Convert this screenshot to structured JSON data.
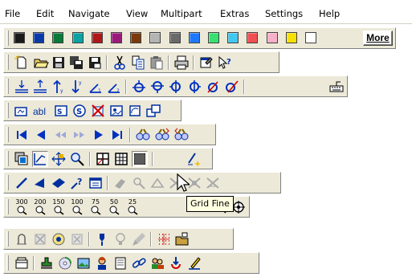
{
  "menu": [
    "File",
    "Edit",
    "Navigate",
    "View",
    "Multipart",
    "Extras",
    "Settings",
    "Help"
  ],
  "palette": {
    "colors": [
      "#1a1a1a",
      "#0a3aa8",
      "#0a7a3a",
      "#0aa2a2",
      "#b01818",
      "#9a1a7a",
      "#7a3a0a",
      "#b4b4b4",
      "#6a6a6a",
      "#1e78ff",
      "#38e070",
      "#40c8f0",
      "#f05050",
      "#f8b0c8",
      "#f8e000",
      "#ffffff"
    ],
    "more_label": "More"
  },
  "tooltip": "Grid Fine",
  "toolbars": {
    "zoom": {
      "labels": [
        "300",
        "200",
        "150",
        "100",
        "75",
        "50",
        "25"
      ]
    }
  },
  "icons": [
    "new-file-icon",
    "open-folder-icon",
    "save-icon",
    "save-all-icon",
    "save-as-icon",
    "cut-icon",
    "copy-icon",
    "paste-icon",
    "print-icon",
    "properties-icon",
    "whats-this-help-icon",
    "align-top-icon",
    "align-bottom-icon",
    "move-up-icon",
    "move-down-icon",
    "angle-up-icon",
    "angle-down-icon",
    "node-top-icon",
    "node-bottom-icon",
    "node-left-icon",
    "node-right-icon",
    "node-delete-icon",
    "node-edit-icon",
    "keyboard-icon",
    "insert-graphic-icon",
    "text-abl-icon",
    "insert-note-icon",
    "symbol-icon",
    "delete-object-icon",
    "insert-image-icon",
    "rotate-object-icon",
    "group-objects-icon",
    "first-page-icon",
    "previous-page-icon",
    "rewind-icon",
    "fast-forward-icon",
    "next-page-icon",
    "last-page-icon",
    "find-icon",
    "find-next-icon",
    "find-previous-icon",
    "layers-icon",
    "draw-edit-icon",
    "move-object-icon",
    "zoom-search-icon",
    "grid-coarse-icon",
    "grid-medium-icon",
    "grid-fine-icon",
    "pen-sparkle-icon",
    "draw-line-icon",
    "arrow-left-icon",
    "arrow-diamond-icon",
    "query-arrow-icon",
    "window-dialog-icon",
    "tool-disabled-1-icon",
    "tool-disabled-2-icon",
    "tool-disabled-3-icon",
    "tool-disabled-4-icon",
    "tool-disabled-5-icon",
    "tool-disabled-6-icon",
    "zoom-300-icon",
    "zoom-200-icon",
    "zoom-150-icon",
    "zoom-100-icon",
    "zoom-75-icon",
    "zoom-50-icon",
    "zoom-25-icon",
    "zoom-custom-icon",
    "zoom-fit-icon",
    "help-tool-icon",
    "cancel-tool-icon",
    "record-icon",
    "stop-disabled-icon",
    "marker-icon",
    "bulb-disabled-icon",
    "brush-disabled-icon",
    "grid-dots-icon",
    "folder-export-icon",
    "trash-toolbar-icon",
    "stamp-icon",
    "cd-target-icon",
    "picture-edit-icon",
    "person-icon",
    "printer-list-icon",
    "link-chain-icon",
    "people-icon",
    "refresh-arrow-icon",
    "pen-check-icon"
  ]
}
